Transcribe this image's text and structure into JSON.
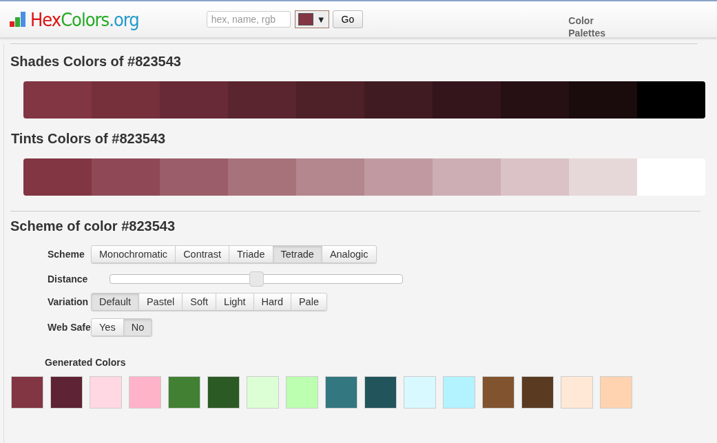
{
  "header": {
    "logo_parts": [
      "Hex",
      "Colors",
      ".org"
    ],
    "search": {
      "placeholder": "hex, name, rgb"
    },
    "picker": {
      "color": "#823543",
      "caret": "▼"
    },
    "go_button": "Go",
    "nav_link": "Color Palettes"
  },
  "shades": {
    "title": "Shades Colors of #823543",
    "swatches": [
      {
        "color": "#823543"
      },
      {
        "color": "#75303c"
      },
      {
        "color": "#682a36"
      },
      {
        "color": "#5b252f"
      },
      {
        "color": "#4e2028"
      },
      {
        "color": "#411b22"
      },
      {
        "color": "#34151b"
      },
      {
        "color": "#271014"
      },
      {
        "color": "#1a0b0d"
      },
      {
        "color": "#000000"
      }
    ]
  },
  "tints": {
    "title": "Tints Colors of #823543",
    "swatches": [
      {
        "color": "#823543"
      },
      {
        "color": "#8f4956"
      },
      {
        "color": "#9b5d69"
      },
      {
        "color": "#a8727b"
      },
      {
        "color": "#b4868e"
      },
      {
        "color": "#c19aa1"
      },
      {
        "color": "#cdaeb4"
      },
      {
        "color": "#dac2c7"
      },
      {
        "color": "#e6d7d9"
      },
      {
        "color": "#ffffff"
      }
    ]
  },
  "scheme": {
    "title": "Scheme of color #823543",
    "rows": [
      {
        "kind": "buttons",
        "label": "Scheme",
        "options": [
          {
            "label": "Monochromatic",
            "selected": false
          },
          {
            "label": "Contrast",
            "selected": false
          },
          {
            "label": "Triade",
            "selected": false
          },
          {
            "label": "Tetrade",
            "selected": true
          },
          {
            "label": "Analogic",
            "selected": false
          }
        ]
      },
      {
        "kind": "slider",
        "label": "Distance",
        "level": 0.5
      },
      {
        "kind": "buttons",
        "label": "Variation",
        "options": [
          {
            "label": "Default",
            "selected": true
          },
          {
            "label": "Pastel",
            "selected": false
          },
          {
            "label": "Soft",
            "selected": false
          },
          {
            "label": "Light",
            "selected": false
          },
          {
            "label": "Hard",
            "selected": false
          },
          {
            "label": "Pale",
            "selected": false
          }
        ]
      },
      {
        "kind": "buttons",
        "label": "Web Safe",
        "options": [
          {
            "label": "Yes",
            "selected": false
          },
          {
            "label": "No",
            "selected": true
          }
        ]
      }
    ]
  },
  "generated": {
    "title": "Generated Colors",
    "swatches": [
      {
        "color": "#823543"
      },
      {
        "color": "#5e2334"
      },
      {
        "color": "#ffd8e4"
      },
      {
        "color": "#ffb3c9"
      },
      {
        "color": "#428034"
      },
      {
        "color": "#2c5a25"
      },
      {
        "color": "#ddffd6"
      },
      {
        "color": "#bcffb0"
      },
      {
        "color": "#337780"
      },
      {
        "color": "#22545b"
      },
      {
        "color": "#d8f9ff"
      },
      {
        "color": "#b2f3ff"
      },
      {
        "color": "#81542f"
      },
      {
        "color": "#5a3b22"
      },
      {
        "color": "#ffe8d6"
      },
      {
        "color": "#ffd3b0"
      }
    ]
  }
}
